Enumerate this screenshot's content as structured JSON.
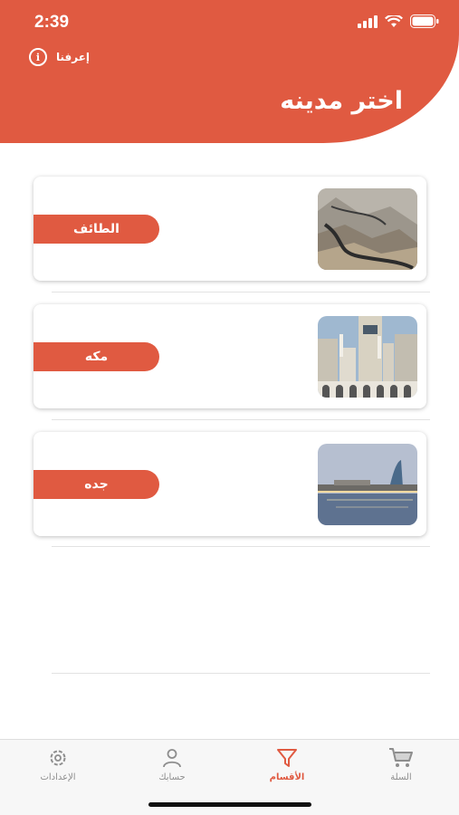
{
  "status": {
    "time": "2:39"
  },
  "header": {
    "about_label": "إعرفنا",
    "title": "اختر مدينه",
    "color": "#e05a41"
  },
  "cities": [
    {
      "name": "الطائف",
      "image": "mountain-road"
    },
    {
      "name": "مكه",
      "image": "clock-tower"
    },
    {
      "name": "جده",
      "image": "waterfront"
    }
  ],
  "tabbar": {
    "items": [
      {
        "label": "الإعدادات",
        "icon": "gear-icon",
        "active": false
      },
      {
        "label": "حسابك",
        "icon": "person-icon",
        "active": false
      },
      {
        "label": "الأقسام",
        "icon": "filter-icon",
        "active": true
      },
      {
        "label": "السلة",
        "icon": "cart-icon",
        "active": false
      }
    ]
  }
}
